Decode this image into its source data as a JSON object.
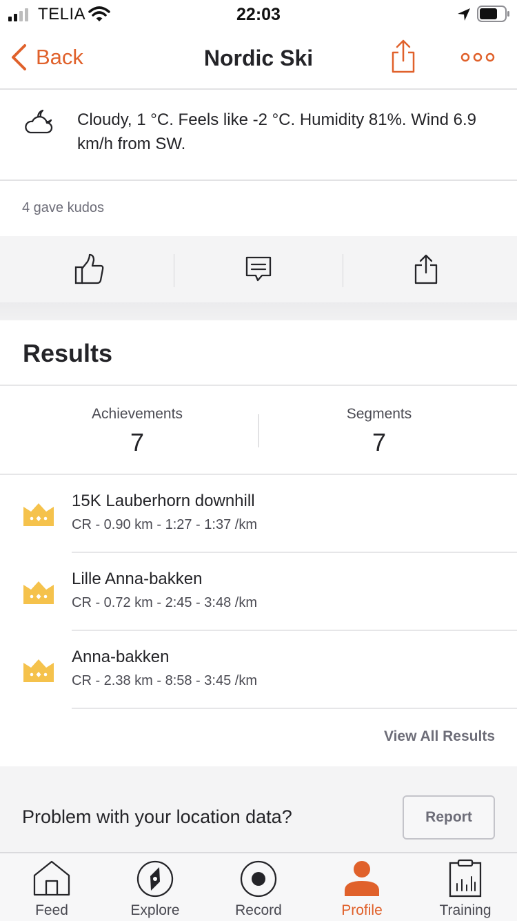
{
  "status_bar": {
    "carrier": "TELIA",
    "time": "22:03"
  },
  "nav": {
    "back_label": "Back",
    "title": "Nordic Ski"
  },
  "weather": {
    "icon": "cloudy-night-icon",
    "text": "Cloudy, 1 °C. Feels like -2 °C. Humidity 81%. Wind 6.9 km/h from SW."
  },
  "kudos": {
    "text": "4 gave kudos"
  },
  "actions": [
    {
      "icon": "thumbs-up-icon"
    },
    {
      "icon": "comment-icon"
    },
    {
      "icon": "share-icon"
    }
  ],
  "results": {
    "title": "Results",
    "stats": [
      {
        "label": "Achievements",
        "value": "7"
      },
      {
        "label": "Segments",
        "value": "7"
      }
    ],
    "items": [
      {
        "name": "15K Lauberhorn downhill",
        "detail": "CR - 0.90 km - 1:27 - 1:37 /km"
      },
      {
        "name": "Lille Anna-bakken",
        "detail": "CR - 0.72 km - 2:45 - 3:48 /km"
      },
      {
        "name": "Anna-bakken",
        "detail": "CR - 2.38 km - 8:58 - 3:45 /km"
      }
    ],
    "view_all_label": "View All Results"
  },
  "problem": {
    "text": "Problem with your location data?",
    "button_label": "Report"
  },
  "tabs": [
    {
      "label": "Feed",
      "icon": "home-icon",
      "active": false
    },
    {
      "label": "Explore",
      "icon": "compass-icon",
      "active": false
    },
    {
      "label": "Record",
      "icon": "record-icon",
      "active": false
    },
    {
      "label": "Profile",
      "icon": "profile-icon",
      "active": true
    },
    {
      "label": "Training",
      "icon": "training-icon",
      "active": false
    }
  ],
  "colors": {
    "accent": "#e0612b",
    "crown": "#f5c24c",
    "text": "#242428",
    "muted": "#6d6d78"
  }
}
